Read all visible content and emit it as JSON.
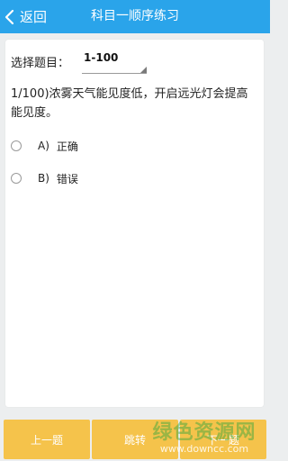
{
  "header": {
    "back_label": "返回",
    "title": "科目一顺序练习"
  },
  "question_picker": {
    "label": "选择题目：",
    "selected": "1-100"
  },
  "question": {
    "text": "1/100)浓雾天气能见度低，开启远光灯会提高能见度。"
  },
  "options": [
    {
      "letter": "A)",
      "text": "正确"
    },
    {
      "letter": "B)",
      "text": "错误"
    }
  ],
  "footer": {
    "prev_label": "上一题",
    "jump_label": "跳转",
    "next_label": "下一题"
  },
  "watermark": {
    "main": "绿色资源网",
    "sub": "www.downcc.com"
  },
  "colors": {
    "header_bg": "#2aa4ea",
    "footer_button_bg": "#f5c34b",
    "page_bg": "#eceeef"
  },
  "icons": {
    "back": "chevron-left-icon"
  }
}
